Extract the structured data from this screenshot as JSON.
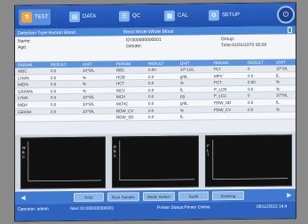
{
  "tabs": [
    {
      "label": "TEST",
      "icon": "test-tube-icon",
      "active": true
    },
    {
      "label": "DATA",
      "icon": "chart-icon",
      "active": false
    },
    {
      "label": "QC",
      "icon": "document-icon",
      "active": false
    },
    {
      "label": "CAL",
      "icon": "calculator-icon",
      "active": false
    },
    {
      "label": "SETUP",
      "icon": "gear-icon",
      "active": false
    }
  ],
  "infobar": {
    "detection": "Detection Type:Human Blood",
    "mode": "Blood Mode:Whole Blood"
  },
  "patient": {
    "name_label": "Name:",
    "age_label": "Age:",
    "id": "ID:000000000001",
    "gender": "Gender:",
    "group": "Group:",
    "time": "Time:01/01/1970 00:00"
  },
  "columns": [
    "PARAM.",
    "RESULT",
    "UNIT",
    "PARAM.",
    "RESULT",
    "UNIT",
    "PARAM.",
    "RESULT",
    "UNIT"
  ],
  "results": [
    [
      [
        "WBC",
        "0.0",
        "10^9/L"
      ],
      [
        "RBC",
        "0.00",
        "10^12/L"
      ],
      [
        "PLT",
        "0",
        "10^9/L"
      ]
    ],
    [
      [
        "LYM%",
        "0.0",
        "%"
      ],
      [
        "HGB",
        "0.0",
        "g/dL"
      ],
      [
        "MPV",
        "0.0",
        "fL"
      ]
    ],
    [
      [
        "MID%",
        "0.0",
        "%"
      ],
      [
        "HCT",
        "0.0",
        "%"
      ],
      [
        "PCT",
        "0.00",
        "%"
      ]
    ],
    [
      [
        "GRAN%",
        "0.0",
        "%"
      ],
      [
        "MCV",
        "0.0",
        "fL"
      ],
      [
        "P_LCR",
        "0.0",
        "%"
      ]
    ],
    [
      [
        "LYM#",
        "0.0",
        "10^9/L"
      ],
      [
        "MCH",
        "0.0",
        "pg"
      ],
      [
        "P_LCC",
        "0",
        "10^9/L"
      ]
    ],
    [
      [
        "MID#",
        "0.0",
        "10^9/L"
      ],
      [
        "MCHC",
        "0.0",
        "g/dL"
      ],
      [
        "PDW_SD",
        "0.0",
        "fL"
      ]
    ],
    [
      [
        "GRAN#",
        "0.0",
        "10^9/L"
      ],
      [
        "RDW_CV",
        "0.0",
        "%"
      ],
      [
        "PDW_CV",
        "0.0",
        "%"
      ]
    ],
    [
      [
        "",
        "",
        ""
      ],
      [
        "RDW_SD",
        "0.0",
        "fL"
      ],
      [
        "",
        "",
        ""
      ]
    ]
  ],
  "charts": [
    {
      "axis": "W B C"
    },
    {
      "axis": "R B C"
    },
    {
      "axis": "P L T"
    }
  ],
  "buttons": [
    "Print",
    "Next Sample",
    "Mode Switch",
    "Audit",
    "Draining"
  ],
  "status": {
    "operator": "Operator: admin",
    "next_id": "Next ID:000000000001",
    "printer": "Printer Status:Printer Online",
    "datetime": "08/11/2023 14:4"
  }
}
